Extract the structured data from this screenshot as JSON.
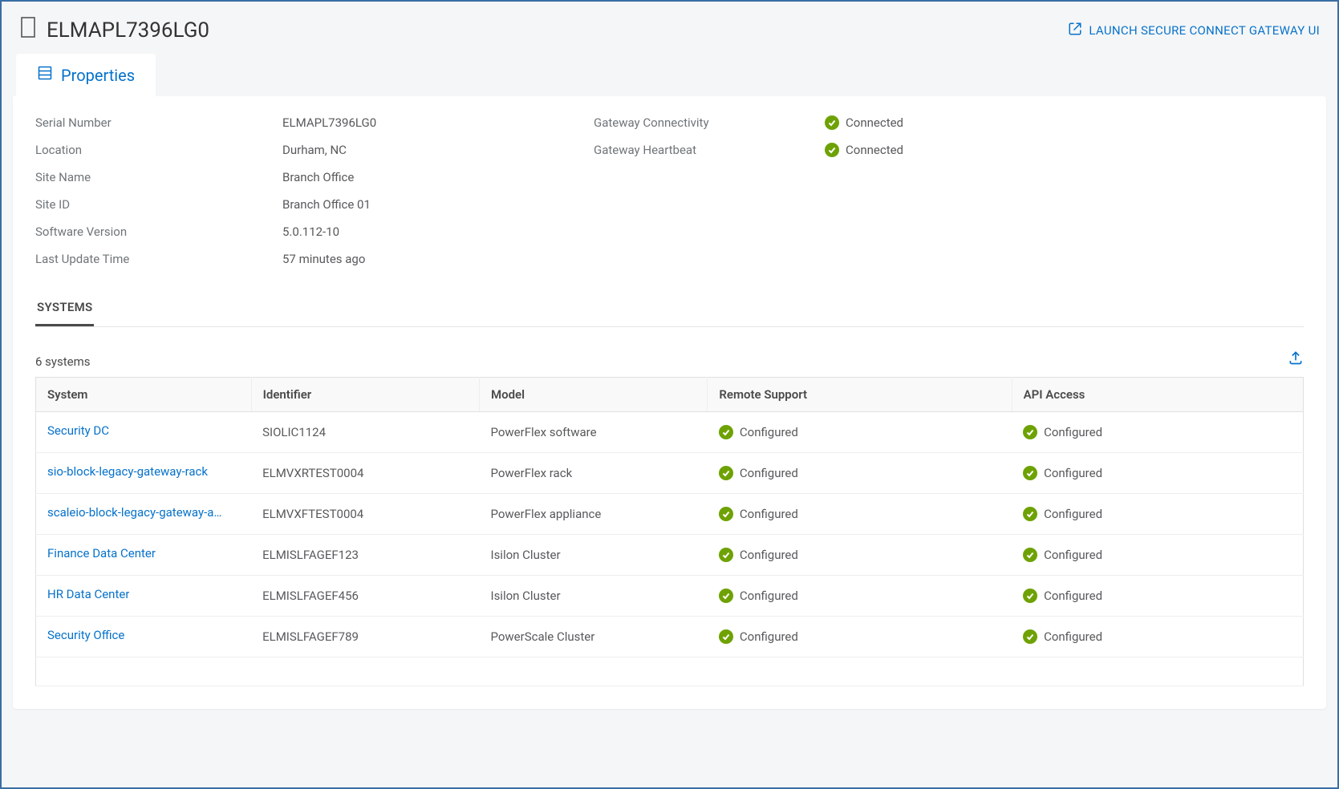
{
  "header": {
    "title": "ELMAPL7396LG0",
    "launch_label": "LAUNCH SECURE CONNECT GATEWAY UI"
  },
  "tabs": {
    "properties_label": "Properties"
  },
  "properties": {
    "labels": {
      "serial_number": "Serial Number",
      "location": "Location",
      "site_name": "Site Name",
      "site_id": "Site ID",
      "software_version": "Software Version",
      "last_update_time": "Last Update Time",
      "gateway_connectivity": "Gateway Connectivity",
      "gateway_heartbeat": "Gateway Heartbeat"
    },
    "values": {
      "serial_number": "ELMAPL7396LG0",
      "location": "Durham, NC",
      "site_name": "Branch Office",
      "site_id": "Branch Office 01",
      "software_version": "5.0.112-10",
      "last_update_time": "57 minutes ago",
      "gateway_connectivity": "Connected",
      "gateway_heartbeat": "Connected"
    }
  },
  "subtabs": {
    "systems_label": "SYSTEMS"
  },
  "systems": {
    "count_label": "6 systems",
    "columns": {
      "system": "System",
      "identifier": "Identifier",
      "model": "Model",
      "remote_support": "Remote Support",
      "api_access": "API Access"
    },
    "rows": [
      {
        "system": "Security DC",
        "identifier": "SIOLIC1124",
        "model": "PowerFlex software",
        "remote_support": "Configured",
        "api_access": "Configured"
      },
      {
        "system": "sio-block-legacy-gateway-rack",
        "identifier": "ELMVXRTEST0004",
        "model": "PowerFlex rack",
        "remote_support": "Configured",
        "api_access": "Configured"
      },
      {
        "system": "scaleio-block-legacy-gateway-ap…",
        "identifier": "ELMVXFTEST0004",
        "model": "PowerFlex appliance",
        "remote_support": "Configured",
        "api_access": "Configured"
      },
      {
        "system": "Finance Data Center",
        "identifier": "ELMISLFAGEF123",
        "model": "Isilon Cluster",
        "remote_support": "Configured",
        "api_access": "Configured"
      },
      {
        "system": "HR Data Center",
        "identifier": "ELMISLFAGEF456",
        "model": "Isilon Cluster",
        "remote_support": "Configured",
        "api_access": "Configured"
      },
      {
        "system": "Security Office",
        "identifier": "ELMISLFAGEF789",
        "model": "PowerScale Cluster",
        "remote_support": "Configured",
        "api_access": "Configured"
      }
    ]
  }
}
